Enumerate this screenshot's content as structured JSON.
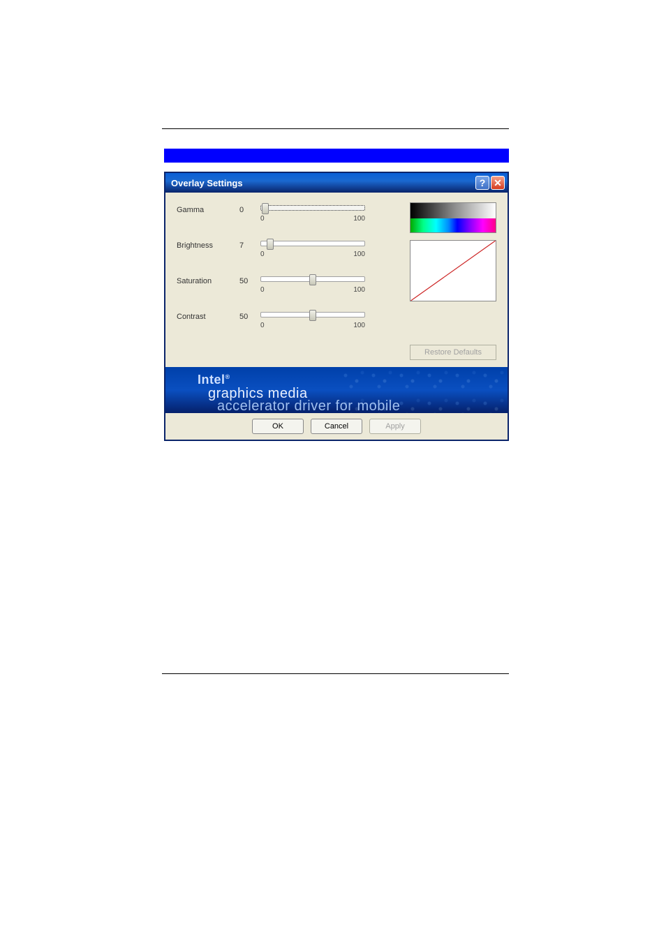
{
  "window": {
    "title": "Overlay Settings"
  },
  "sliders": {
    "gamma": {
      "label": "Gamma",
      "value": "0",
      "min": "0",
      "max": "100",
      "percent": 4
    },
    "brightness": {
      "label": "Brightness",
      "value": "7",
      "min": "0",
      "max": "100",
      "percent": 9
    },
    "saturation": {
      "label": "Saturation",
      "value": "50",
      "min": "0",
      "max": "100",
      "percent": 50
    },
    "contrast": {
      "label": "Contrast",
      "value": "50",
      "min": "0",
      "max": "100",
      "percent": 50
    }
  },
  "buttons": {
    "restore": "Restore Defaults",
    "ok": "OK",
    "cancel": "Cancel",
    "apply": "Apply"
  },
  "banner": {
    "brand": "Intel",
    "line1": "graphics media",
    "line2": "accelerator driver for mobile"
  }
}
